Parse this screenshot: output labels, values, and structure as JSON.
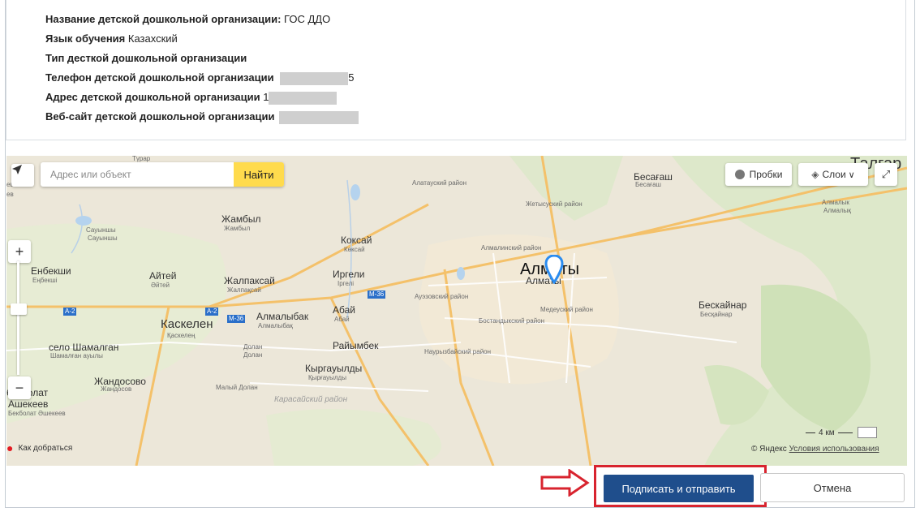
{
  "info": {
    "org_name_label": "Название детской дошкольной организации:",
    "org_name_value": "ГОС ДДО",
    "lang_label": "Язык обучения",
    "lang_value": "Казахский",
    "type_label": "Тип десткой дошкольной организации",
    "phone_label": "Телефон детской дошкольной организации",
    "phone_tail": "5",
    "address_label": "Адрес детской дошкольной организации",
    "address_head": "1",
    "web_label": "Веб-сайт детской дошкольной организации"
  },
  "map": {
    "search_placeholder": "Адрес или объект",
    "search_button": "Найти",
    "traffic_label": "Пробки",
    "layers_label": "Слои",
    "layers_extra": "∨ ",
    "route_label": "Как добраться",
    "scale_label": "4 км",
    "copyright": "© Яндекс",
    "terms_link": "Условия использования",
    "road_labels": [
      "М-36",
      "А-2",
      "А-2",
      "М-36"
    ],
    "places": [
      {
        "name": "Түрар",
        "sub": ""
      },
      {
        "name": "Талгар",
        "sub": ""
      },
      {
        "name": "Бесағаш",
        "sub": "Бесағаш"
      },
      {
        "name": "Алматы",
        "sub": "Алматы"
      },
      {
        "name": "Жамбыл",
        "sub": "Жамбыл"
      },
      {
        "name": "Сауыншы",
        "sub": "Сауыншы"
      },
      {
        "name": "Коксай",
        "sub": "Көксай"
      },
      {
        "name": "Енбекши",
        "sub": "Еңбекші"
      },
      {
        "name": "Айтей",
        "sub": "Әйтей"
      },
      {
        "name": "Жалпаксай",
        "sub": "Жалпақсай"
      },
      {
        "name": "Иргели",
        "sub": "Іргелі"
      },
      {
        "name": "Каскелен",
        "sub": "Қаскелең"
      },
      {
        "name": "Алмалыбак",
        "sub": "Алмалыбақ"
      },
      {
        "name": "Абай",
        "sub": "Абай"
      },
      {
        "name": "село Шамалган",
        "sub": "Шамалған ауылы"
      },
      {
        "name": "Долан",
        "sub": "Долан"
      },
      {
        "name": "Райымбек",
        "sub": ""
      },
      {
        "name": "Жандосово",
        "sub": "Жандосов"
      },
      {
        "name": "Кыргауылды",
        "sub": "Қырғауылды"
      },
      {
        "name": "Малый Долан",
        "sub": ""
      },
      {
        "name": "Бескайнар",
        "sub": "Бесқайнар"
      },
      {
        "name": "Алмалык",
        "sub": "Алмалық"
      },
      {
        "name": "бекболат",
        "sub": ""
      },
      {
        "name": "Ашекеев",
        "sub": ""
      },
      {
        "name": "Бекболат Әшекеев",
        "sub": ""
      },
      {
        "name": "ево",
        "sub": ""
      },
      {
        "name": "ев",
        "sub": ""
      }
    ],
    "districts": [
      "Алатауский район",
      "Жетысуский район",
      "Алмалинский район",
      "Ауэзовский район",
      "Медеуский район",
      "Бостандыкский район",
      "Наурызбайский район",
      "Карасайский район"
    ]
  },
  "actions": {
    "submit": "Подписать и отправить",
    "cancel": "Отмена"
  },
  "colors": {
    "primary": "#1f4e8c",
    "highlight": "#d8242f",
    "find_button": "#ffdb4d"
  }
}
